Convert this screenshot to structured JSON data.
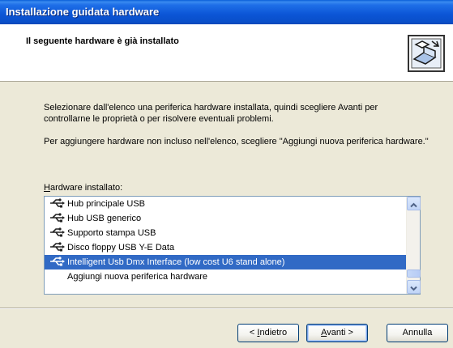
{
  "window": {
    "title": "Installazione guidata hardware"
  },
  "header": {
    "title": "Il seguente hardware è già installato",
    "icon": "hardware-wizard-icon"
  },
  "content": {
    "paragraph1": "Selezionare dall'elenco una periferica hardware installata, quindi scegliere Avanti per controllarne le proprietà o per risolvere eventuali problemi.",
    "paragraph2": "Per aggiungere hardware non incluso nell'elenco, scegliere \"Aggiungi nuova periferica hardware.\"",
    "list_label_accel": "H",
    "list_label_rest": "ardware installato:",
    "items": [
      {
        "label": "Hub principale USB",
        "icon": "usb-icon"
      },
      {
        "label": "Hub USB generico",
        "icon": "usb-icon"
      },
      {
        "label": "Supporto stampa USB",
        "icon": "usb-icon"
      },
      {
        "label": "Disco floppy USB Y-E Data",
        "icon": "usb-icon"
      },
      {
        "label": "Intelligent Usb Dmx Interface (low cost U6 stand alone)",
        "icon": "usb-icon",
        "selected": true
      },
      {
        "label": "Aggiungi nuova periferica hardware"
      }
    ]
  },
  "buttons": {
    "back_prefix": "< ",
    "back_accel": "I",
    "back_rest": "ndietro",
    "next_accel": "A",
    "next_rest": "vanti >",
    "cancel": "Annulla"
  },
  "colors": {
    "selection": "#316ac5",
    "titlebar": "#0b55d6",
    "dialog_bg": "#ece9d8"
  }
}
